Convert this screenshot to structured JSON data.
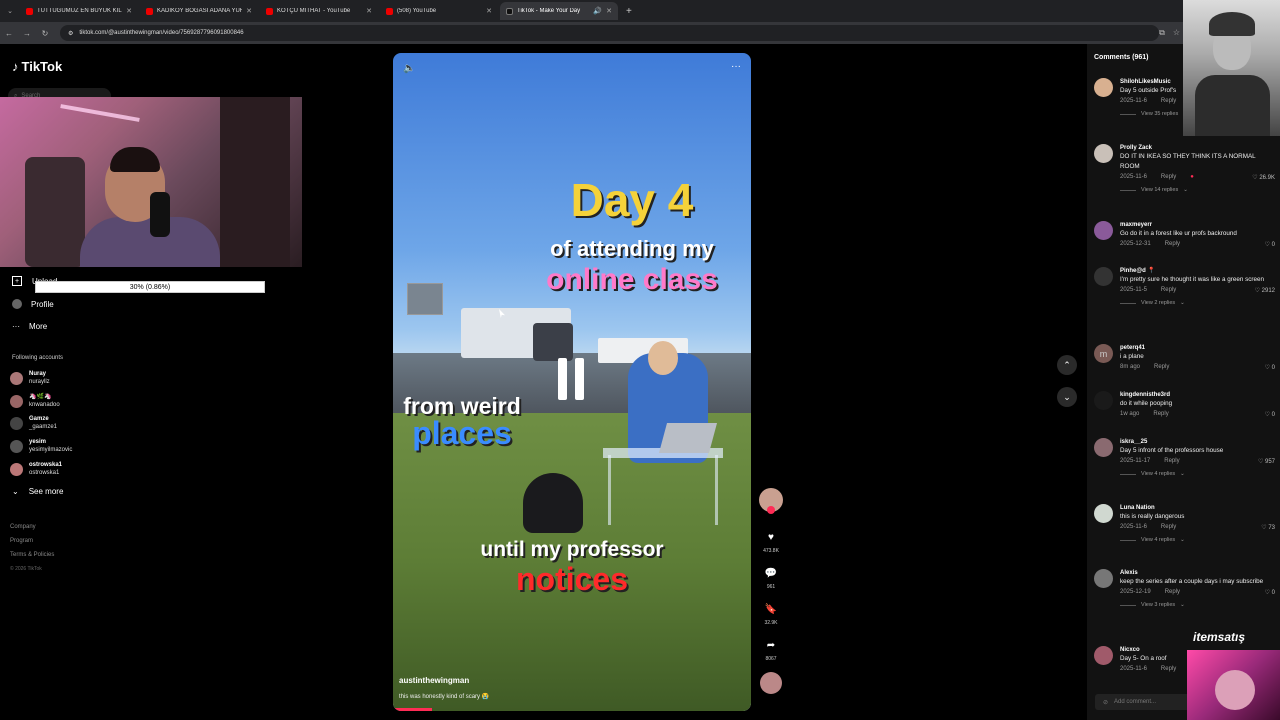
{
  "browser": {
    "tabs": [
      {
        "title": "TUTTUĞUMUZ EN BÜYÜK KILIÇ",
        "icon": "youtube-icon",
        "audio": false
      },
      {
        "title": "KADIKÖY BOĞASI ADANA YÜRÜ",
        "icon": "youtube-icon",
        "audio": false
      },
      {
        "title": "KOTÇU MİTHAT - YouTube",
        "icon": "youtube-icon",
        "audio": false
      },
      {
        "title": "(508) YouTube",
        "icon": "youtube-icon",
        "audio": false
      },
      {
        "title": "TikTok - Make Your Day",
        "icon": "tiktok-icon",
        "audio": true,
        "active": true
      }
    ],
    "url": "tiktok.com/@austinthewingman/video/7569287796091800846"
  },
  "sidebar": {
    "logo": "TikTok",
    "search_placeholder": "Search",
    "upload_label": "Upload",
    "upload_progress": "30% (0.86%)",
    "profile_label": "Profile",
    "more_label": "More",
    "following_title": "Following accounts",
    "accounts": [
      {
        "name": "Nuray",
        "handle": "nurayllz"
      },
      {
        "name": "🦄🌿🦄",
        "handle": "knwanadoo"
      },
      {
        "name": "Gamze",
        "handle": "_gaamze1"
      },
      {
        "name": "yesim",
        "handle": "yesimyilmazovic"
      },
      {
        "name": "ostrowska1",
        "handle": "ostrowska1"
      }
    ],
    "see_more": "See more",
    "footer": [
      "Company",
      "Program",
      "Terms & Policies"
    ],
    "copyright": "© 2026 TikTok"
  },
  "video": {
    "overlay_day": "Day 4",
    "overlay_attending": "of attending my",
    "overlay_online": "online class",
    "overlay_weird": "from weird",
    "overlay_places": "places",
    "overlay_until": "until my professor",
    "overlay_notices": "notices",
    "author": "austinthewingman",
    "caption": "this was honestly kind of scary 😭",
    "progress_fraction": 0.11
  },
  "actions": {
    "likes": "473.8K",
    "comments": "961",
    "saves": "32.9K",
    "shares": "8067"
  },
  "comments": {
    "title": "Comments (961)",
    "add_placeholder": "Add comment...",
    "reply_label": "Reply",
    "items": [
      {
        "user": "ShilohLikesMusic",
        "text": "Day 5 outside Prof's",
        "date": "2025-11-6",
        "likes": "",
        "replies": "View 35 replies"
      },
      {
        "user": "Prolly Zack",
        "text": "DO IT IN IKEA SO THEY THINK ITS A NORMAL ROOM",
        "date": "2025-11-6",
        "likes": "26.9K",
        "replies": "View 14 replies"
      },
      {
        "user": "maxmeyerr",
        "text": "Go do it in a forest like ur profs backround",
        "date": "2025-12-31",
        "likes": "0",
        "replies": ""
      },
      {
        "user": "Pinhe@d 📍",
        "text": "I'm pretty sure he thought it was like a green screen",
        "date": "2025-11-5",
        "likes": "2912",
        "replies": "View 2 replies"
      },
      {
        "user": "peterq41",
        "text": "i a plane",
        "date": "8m ago",
        "likes": "0",
        "replies": ""
      },
      {
        "user": "kingdennisthe3rd",
        "text": "do it while pooping",
        "date": "1w ago",
        "likes": "0",
        "replies": ""
      },
      {
        "user": "iskra__25",
        "text": "Day 5 infront of the professors house",
        "date": "2025-11-17",
        "likes": "957",
        "replies": "View 4 replies"
      },
      {
        "user": "Luna Nation",
        "text": "this is really dangerous",
        "date": "2025-11-6",
        "likes": "73",
        "replies": "View 4 replies"
      },
      {
        "user": "Alexis",
        "text": "keep the series after a couple days i may subscribe",
        "date": "2025-12-19",
        "likes": "0",
        "replies": "View 3 replies"
      },
      {
        "user": "Nicxco",
        "text": "Day 5- On a roof",
        "date": "2025-11-6",
        "likes": "",
        "replies": ""
      }
    ]
  },
  "overlay": {
    "brand": "itemsatış"
  }
}
